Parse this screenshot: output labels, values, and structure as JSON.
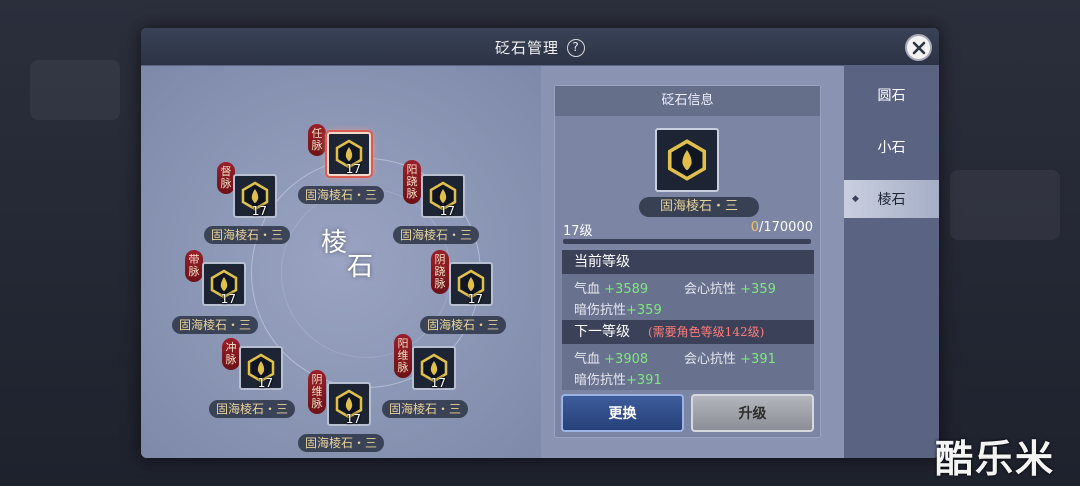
{
  "modal": {
    "title": "砭石管理",
    "help_icon": "?"
  },
  "center_label": {
    "char1": "棱",
    "char2": "石"
  },
  "slots": [
    {
      "meridian": "任脉",
      "level": "17",
      "name": "固海棱石・三",
      "selected": true
    },
    {
      "meridian": "督脉",
      "level": "17",
      "name": "固海棱石・三"
    },
    {
      "meridian": "阳跷脉",
      "level": "17",
      "name": "固海棱石・三"
    },
    {
      "meridian": "带脉",
      "level": "17",
      "name": "固海棱石・三"
    },
    {
      "meridian": "阴跷脉",
      "level": "17",
      "name": "固海棱石・三"
    },
    {
      "meridian": "冲脉",
      "level": "17",
      "name": "固海棱石・三"
    },
    {
      "meridian": "阳维脉",
      "level": "17",
      "name": "固海棱石・三"
    },
    {
      "meridian": "阴维脉",
      "level": "17",
      "name": "固海棱石・三"
    }
  ],
  "info": {
    "title": "砭石信息",
    "gem_name": "固海棱石・三",
    "level_label": "17级",
    "exp_current": "0",
    "exp_total": "/170000",
    "exp_progress": 0,
    "current": {
      "heading": "当前等级",
      "stats": [
        {
          "label": "气血",
          "value": "+3589"
        },
        {
          "label": "会心抗性",
          "value": "+359"
        },
        {
          "label": "暗伤抗性",
          "value": "+359"
        }
      ]
    },
    "next": {
      "heading": "下一等级",
      "requirement": "(需要角色等级142级)",
      "stats": [
        {
          "label": "气血",
          "value": "+3908"
        },
        {
          "label": "会心抗性",
          "value": "+391"
        },
        {
          "label": "暗伤抗性",
          "value": "+391"
        }
      ]
    },
    "replace_label": "更换",
    "upgrade_label": "升级"
  },
  "tabs": [
    {
      "label": "圆石"
    },
    {
      "label": "小石"
    },
    {
      "label": "棱石",
      "active": true
    }
  ],
  "watermark": "酷乐米",
  "colors": {
    "stat_value": "#7fe67f",
    "requirement": "#ff7c78",
    "gem_name": "#e8d39a",
    "meridian_tag": "#9a1f2a"
  }
}
